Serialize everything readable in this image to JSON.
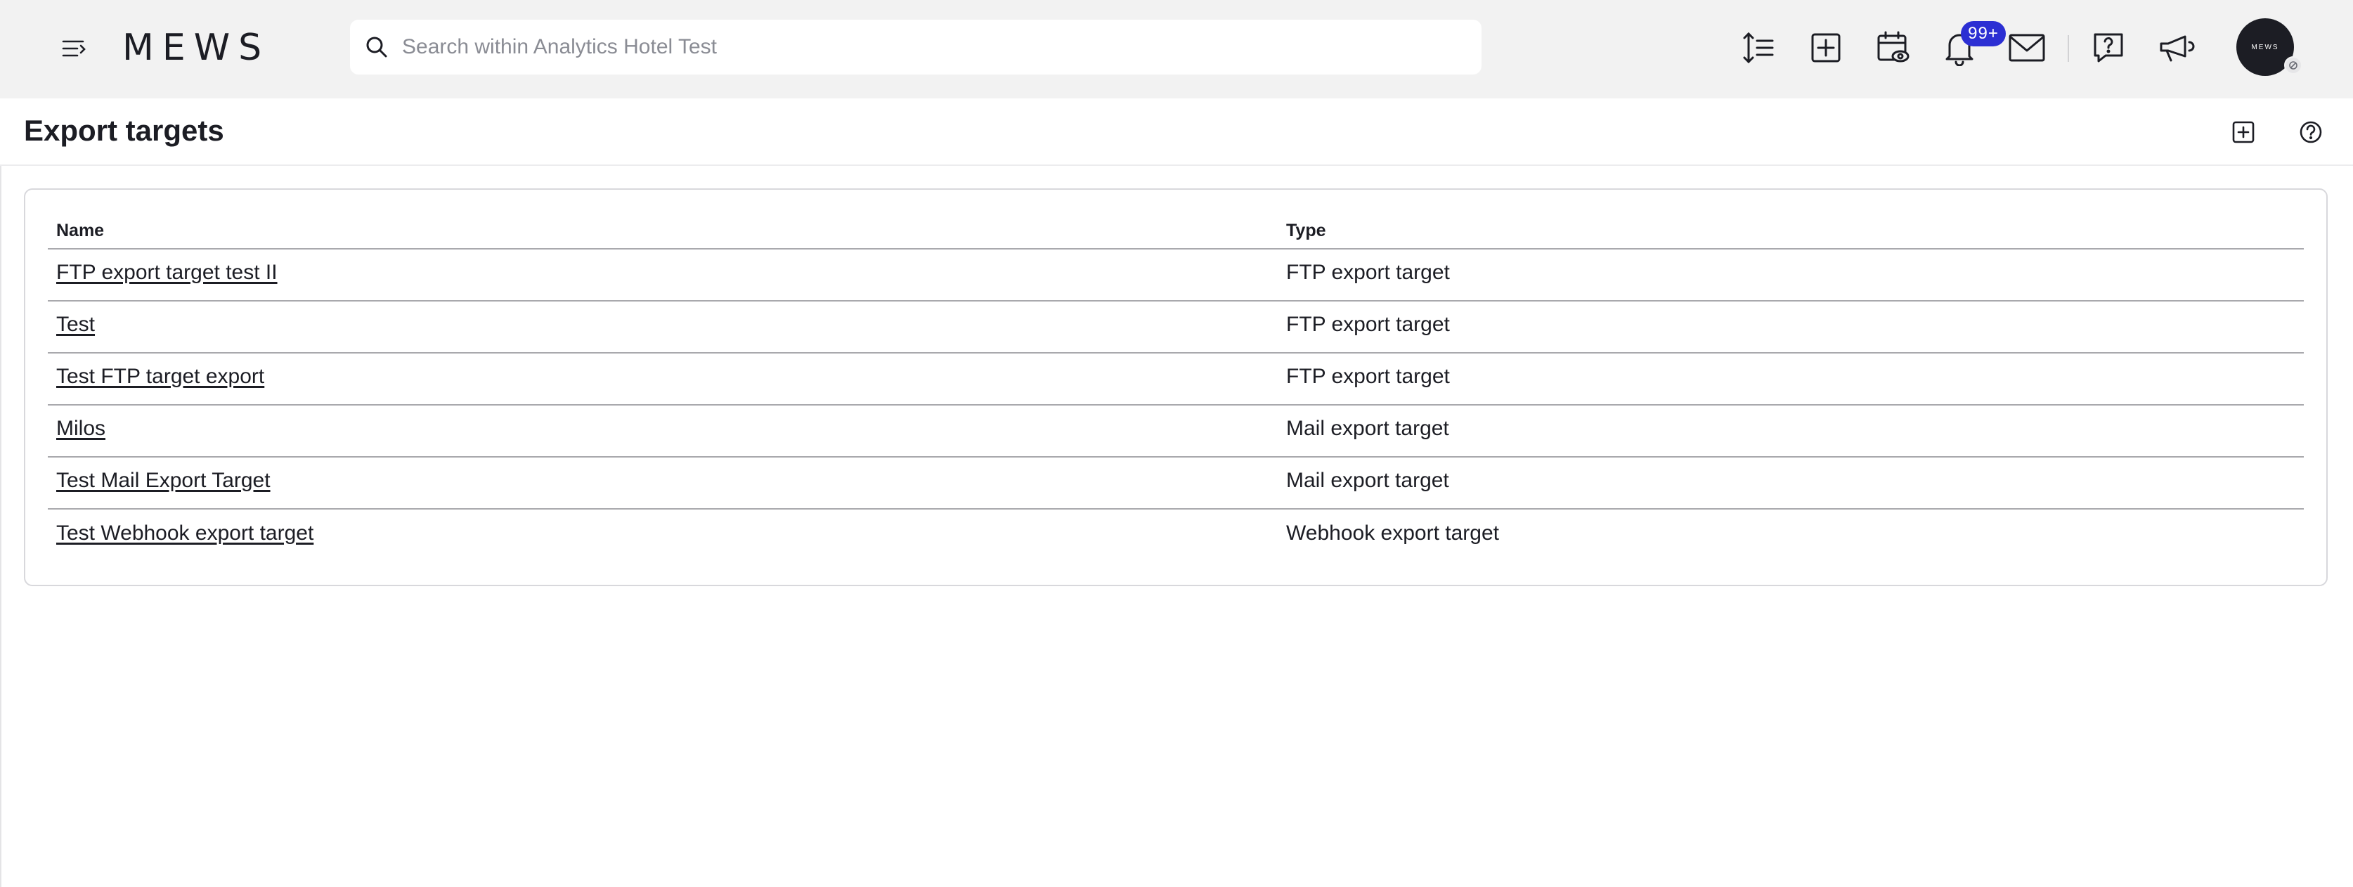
{
  "topbar": {
    "logo": "MEWS",
    "search_placeholder": "Search within Analytics Hotel Test",
    "notification_badge": "99+",
    "avatar_text": "MEWS",
    "icons": [
      "menu-icon",
      "density-icon",
      "add-icon",
      "calendar-view-icon",
      "bell-icon",
      "mail-icon",
      "help-chat-icon",
      "megaphone-icon"
    ]
  },
  "page": {
    "title": "Export targets"
  },
  "table": {
    "headers": {
      "name": "Name",
      "type": "Type"
    },
    "rows": [
      {
        "name": "FTP export target test II",
        "type": "FTP export target"
      },
      {
        "name": "Test",
        "type": "FTP export target"
      },
      {
        "name": "Test FTP target export",
        "type": "FTP export target"
      },
      {
        "name": "Milos",
        "type": "Mail export target"
      },
      {
        "name": "Test Mail Export Target",
        "type": "Mail export target"
      },
      {
        "name": "Test Webhook export target",
        "type": "Webhook export target"
      }
    ]
  },
  "colors": {
    "topbar_bg": "#f2f2f2",
    "badge": "#2c2fd3",
    "text": "#1c1d24",
    "avatar_bg": "#1c1d24"
  }
}
